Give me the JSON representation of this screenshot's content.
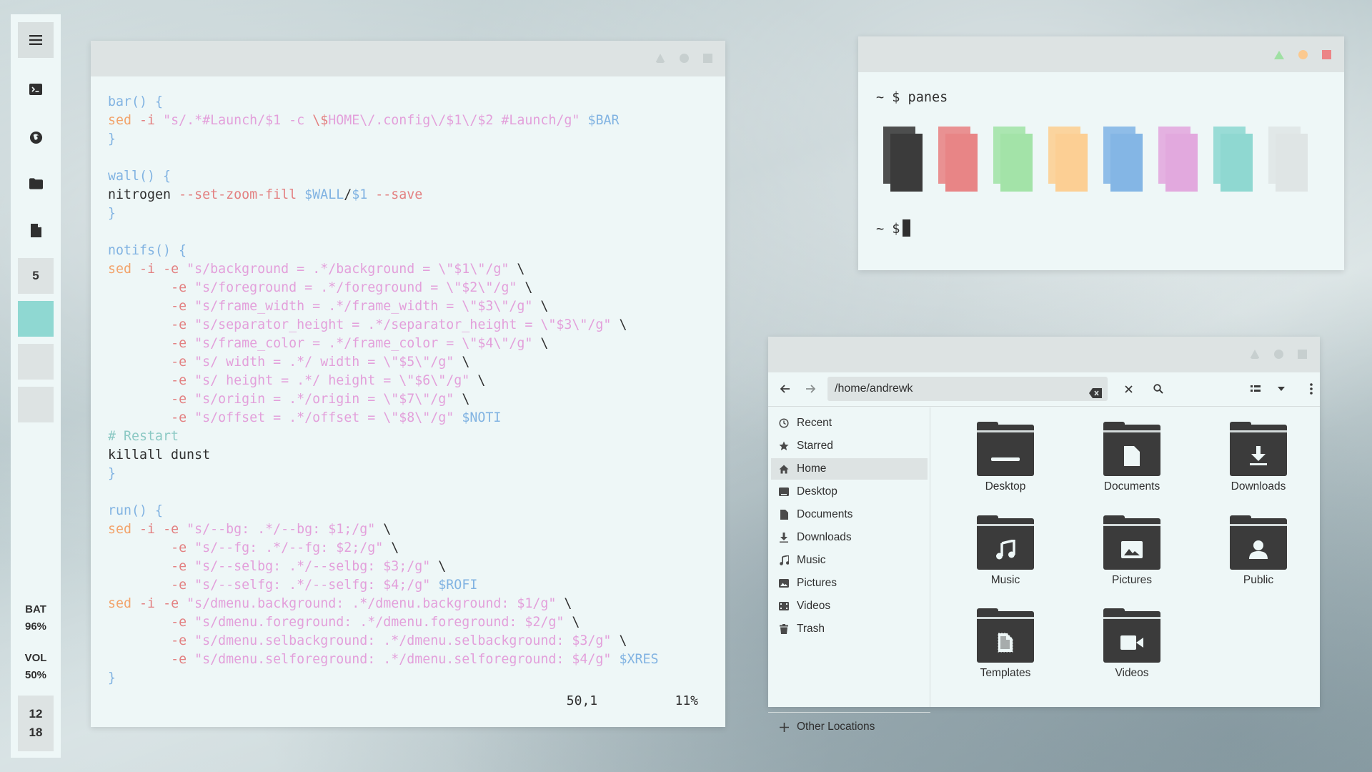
{
  "dock": {
    "workspace_label": "5",
    "battery": {
      "label": "BAT",
      "value": "96%"
    },
    "volume": {
      "label": "VOL",
      "value": "50%"
    },
    "clock": {
      "hour": "12",
      "minute": "18"
    },
    "icons": [
      "menu-icon",
      "terminal-icon",
      "firefox-icon",
      "folder-icon",
      "file-icon"
    ]
  },
  "editor": {
    "lines": [
      [
        [
          "c-kw",
          "bar() {"
        ]
      ],
      [
        [
          "c-sed",
          "sed"
        ],
        [
          "c-plain",
          " "
        ],
        [
          "c-flag",
          "-i"
        ],
        [
          "c-plain",
          " "
        ],
        [
          "c-str",
          "\"s/.*#Launch/$1 -c "
        ],
        [
          "c-flag",
          "\\$"
        ],
        [
          "c-str",
          "HOME\\/.config\\/$1\\/$2 #Launch/g\""
        ],
        [
          "c-plain",
          " "
        ],
        [
          "c-var",
          "$BAR"
        ]
      ],
      [
        [
          "c-kw",
          "}"
        ]
      ],
      [
        [
          "c-plain",
          ""
        ]
      ],
      [
        [
          "c-kw",
          "wall() {"
        ]
      ],
      [
        [
          "c-plain",
          "nitrogen "
        ],
        [
          "c-flag",
          "--set-zoom-fill"
        ],
        [
          "c-plain",
          " "
        ],
        [
          "c-var",
          "$WALL"
        ],
        [
          "c-plain",
          "/"
        ],
        [
          "c-var",
          "$1"
        ],
        [
          "c-plain",
          " "
        ],
        [
          "c-flag",
          "--save"
        ]
      ],
      [
        [
          "c-kw",
          "}"
        ]
      ],
      [
        [
          "c-plain",
          ""
        ]
      ],
      [
        [
          "c-kw",
          "notifs() {"
        ]
      ],
      [
        [
          "c-sed",
          "sed"
        ],
        [
          "c-plain",
          " "
        ],
        [
          "c-flag",
          "-i -e"
        ],
        [
          "c-plain",
          " "
        ],
        [
          "c-str",
          "\"s/background = .*/background = \\\"$1\\\"/g\""
        ],
        [
          "c-plain",
          " \\"
        ]
      ],
      [
        [
          "c-plain",
          "        "
        ],
        [
          "c-flag",
          "-e"
        ],
        [
          "c-plain",
          " "
        ],
        [
          "c-str",
          "\"s/foreground = .*/foreground = \\\"$2\\\"/g\""
        ],
        [
          "c-plain",
          " \\"
        ]
      ],
      [
        [
          "c-plain",
          "        "
        ],
        [
          "c-flag",
          "-e"
        ],
        [
          "c-plain",
          " "
        ],
        [
          "c-str",
          "\"s/frame_width = .*/frame_width = \\\"$3\\\"/g\""
        ],
        [
          "c-plain",
          " \\"
        ]
      ],
      [
        [
          "c-plain",
          "        "
        ],
        [
          "c-flag",
          "-e"
        ],
        [
          "c-plain",
          " "
        ],
        [
          "c-str",
          "\"s/separator_height = .*/separator_height = \\\"$3\\\"/g\""
        ],
        [
          "c-plain",
          " \\"
        ]
      ],
      [
        [
          "c-plain",
          "        "
        ],
        [
          "c-flag",
          "-e"
        ],
        [
          "c-plain",
          " "
        ],
        [
          "c-str",
          "\"s/frame_color = .*/frame_color = \\\"$4\\\"/g\""
        ],
        [
          "c-plain",
          " \\"
        ]
      ],
      [
        [
          "c-plain",
          "        "
        ],
        [
          "c-flag",
          "-e"
        ],
        [
          "c-plain",
          " "
        ],
        [
          "c-str",
          "\"s/ width = .*/ width = \\\"$5\\\"/g\""
        ],
        [
          "c-plain",
          " \\"
        ]
      ],
      [
        [
          "c-plain",
          "        "
        ],
        [
          "c-flag",
          "-e"
        ],
        [
          "c-plain",
          " "
        ],
        [
          "c-str",
          "\"s/ height = .*/ height = \\\"$6\\\"/g\""
        ],
        [
          "c-plain",
          " \\"
        ]
      ],
      [
        [
          "c-plain",
          "        "
        ],
        [
          "c-flag",
          "-e"
        ],
        [
          "c-plain",
          " "
        ],
        [
          "c-str",
          "\"s/origin = .*/origin = \\\"$7\\\"/g\""
        ],
        [
          "c-plain",
          " \\"
        ]
      ],
      [
        [
          "c-plain",
          "        "
        ],
        [
          "c-flag",
          "-e"
        ],
        [
          "c-plain",
          " "
        ],
        [
          "c-str",
          "\"s/offset = .*/offset = \\\"$8\\\"/g\""
        ],
        [
          "c-plain",
          " "
        ],
        [
          "c-var",
          "$NOTI"
        ]
      ],
      [
        [
          "c-comment",
          "# Restart"
        ]
      ],
      [
        [
          "c-plain",
          "killall dunst"
        ]
      ],
      [
        [
          "c-kw",
          "}"
        ]
      ],
      [
        [
          "c-plain",
          ""
        ]
      ],
      [
        [
          "c-kw",
          "run() {"
        ]
      ],
      [
        [
          "c-sed",
          "sed"
        ],
        [
          "c-plain",
          " "
        ],
        [
          "c-flag",
          "-i -e"
        ],
        [
          "c-plain",
          " "
        ],
        [
          "c-str",
          "\"s/--bg: .*/--bg: $1;/g\""
        ],
        [
          "c-plain",
          " \\"
        ]
      ],
      [
        [
          "c-plain",
          "        "
        ],
        [
          "c-flag",
          "-e"
        ],
        [
          "c-plain",
          " "
        ],
        [
          "c-str",
          "\"s/--fg: .*/--fg: $2;/g\""
        ],
        [
          "c-plain",
          " \\"
        ]
      ],
      [
        [
          "c-plain",
          "        "
        ],
        [
          "c-flag",
          "-e"
        ],
        [
          "c-plain",
          " "
        ],
        [
          "c-str",
          "\"s/--selbg: .*/--selbg: $3;/g\""
        ],
        [
          "c-plain",
          " \\"
        ]
      ],
      [
        [
          "c-plain",
          "        "
        ],
        [
          "c-flag",
          "-e"
        ],
        [
          "c-plain",
          " "
        ],
        [
          "c-str",
          "\"s/--selfg: .*/--selfg: $4;/g\""
        ],
        [
          "c-plain",
          " "
        ],
        [
          "c-var",
          "$ROFI"
        ]
      ],
      [
        [
          "c-sed",
          "sed"
        ],
        [
          "c-plain",
          " "
        ],
        [
          "c-flag",
          "-i -e"
        ],
        [
          "c-plain",
          " "
        ],
        [
          "c-str",
          "\"s/dmenu.background: .*/dmenu.background: $1/g\""
        ],
        [
          "c-plain",
          " \\"
        ]
      ],
      [
        [
          "c-plain",
          "        "
        ],
        [
          "c-flag",
          "-e"
        ],
        [
          "c-plain",
          " "
        ],
        [
          "c-str",
          "\"s/dmenu.foreground: .*/dmenu.foreground: $2/g\""
        ],
        [
          "c-plain",
          " \\"
        ]
      ],
      [
        [
          "c-plain",
          "        "
        ],
        [
          "c-flag",
          "-e"
        ],
        [
          "c-plain",
          " "
        ],
        [
          "c-str",
          "\"s/dmenu.selbackground: .*/dmenu.selbackground: $3/g\""
        ],
        [
          "c-plain",
          " \\"
        ]
      ],
      [
        [
          "c-plain",
          "        "
        ],
        [
          "c-flag",
          "-e"
        ],
        [
          "c-plain",
          " "
        ],
        [
          "c-str",
          "\"s/dmenu.selforeground: .*/dmenu.selforeground: $4/g\""
        ],
        [
          "c-plain",
          " "
        ],
        [
          "c-var",
          "$XRES"
        ]
      ],
      [
        [
          "c-kw",
          "}"
        ]
      ]
    ],
    "status": "50,1          11%"
  },
  "terminal": {
    "prompt1": "~ $ panes",
    "prompt2": "~ $",
    "panes": [
      {
        "color": "#3b3b3b"
      },
      {
        "color": "#e88586"
      },
      {
        "color": "#a3e3a8"
      },
      {
        "color": "#fccf94"
      },
      {
        "color": "#84b6e5"
      },
      {
        "color": "#e2a9de"
      },
      {
        "color": "#8fd8d1"
      },
      {
        "color": "#dfe5e5"
      }
    ]
  },
  "files": {
    "path": "/home/andrewk",
    "sidebar": [
      {
        "label": "Recent",
        "icon": "clock-icon"
      },
      {
        "label": "Starred",
        "icon": "star-icon"
      },
      {
        "label": "Home",
        "icon": "home-icon",
        "selected": true
      },
      {
        "label": "Desktop",
        "icon": "desktop-icon"
      },
      {
        "label": "Documents",
        "icon": "document-icon"
      },
      {
        "label": "Downloads",
        "icon": "download-icon"
      },
      {
        "label": "Music",
        "icon": "music-icon"
      },
      {
        "label": "Pictures",
        "icon": "picture-icon"
      },
      {
        "label": "Videos",
        "icon": "video-icon"
      },
      {
        "label": "Trash",
        "icon": "trash-icon"
      }
    ],
    "other_locations": "Other Locations",
    "items": [
      {
        "label": "Desktop",
        "icon": "desktop-folder-icon"
      },
      {
        "label": "Documents",
        "icon": "documents-folder-icon"
      },
      {
        "label": "Downloads",
        "icon": "downloads-folder-icon"
      },
      {
        "label": "Music",
        "icon": "music-folder-icon"
      },
      {
        "label": "Pictures",
        "icon": "pictures-folder-icon"
      },
      {
        "label": "Public",
        "icon": "public-folder-icon"
      },
      {
        "label": "Templates",
        "icon": "templates-folder-icon"
      },
      {
        "label": "Videos",
        "icon": "videos-folder-icon"
      }
    ]
  }
}
